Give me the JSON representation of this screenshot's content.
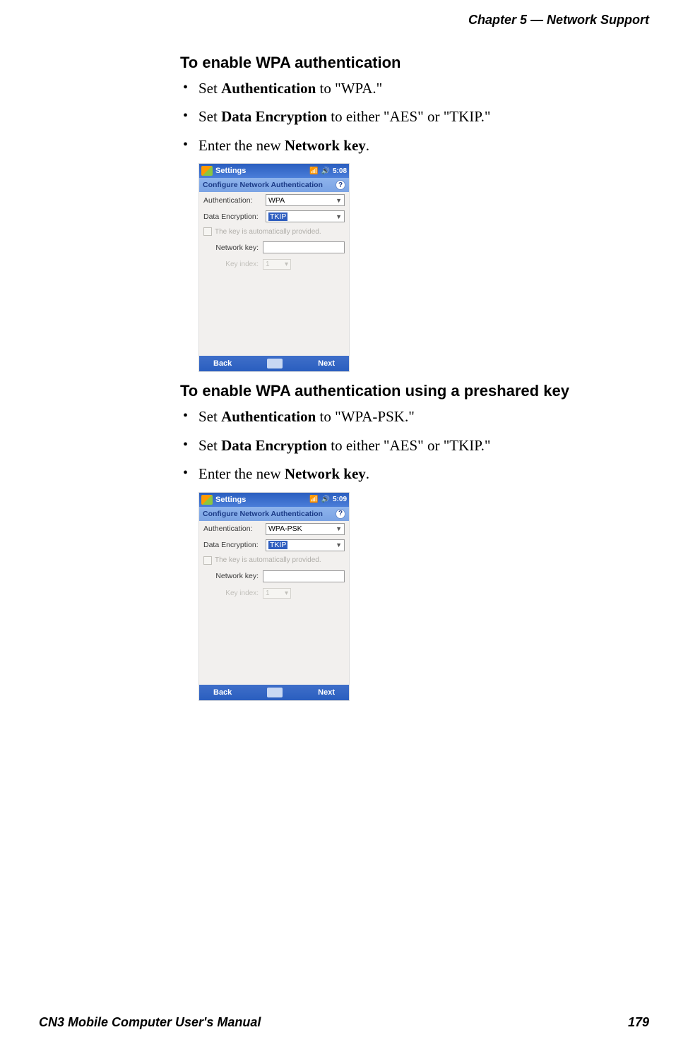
{
  "header": {
    "chapter": "Chapter 5 —  Network Support"
  },
  "footer": {
    "manual": "CN3 Mobile Computer User's Manual",
    "page": "179"
  },
  "section1": {
    "heading": "To enable WPA authentication",
    "b1_pre": "Set ",
    "b1_bold": "Authentication",
    "b1_post": " to \"WPA.\"",
    "b2_pre": "Set ",
    "b2_bold": "Data Encryption",
    "b2_post": " to either \"AES\" or \"TKIP.\"",
    "b3_pre": "Enter the new ",
    "b3_bold": "Network key",
    "b3_post": "."
  },
  "section2": {
    "heading": "To enable WPA authentication using a preshared key",
    "b1_pre": "Set ",
    "b1_bold": "Authentication",
    "b1_post": " to \"WPA-PSK.\"",
    "b2_pre": "Set ",
    "b2_bold": "Data Encryption",
    "b2_post": " to either \"AES\" or \"TKIP.\"",
    "b3_pre": "Enter the new ",
    "b3_bold": "Network key",
    "b3_post": "."
  },
  "screenshot1": {
    "title": "Settings",
    "time": "5:08",
    "subtitle": "Configure Network Authentication",
    "auth_label": "Authentication:",
    "auth_value": "WPA",
    "enc_label": "Data Encryption:",
    "enc_value": "TKIP",
    "auto_text": "The key is automatically provided.",
    "net_label": "Network key:",
    "keyidx_label": "Key index:",
    "keyidx_value": "1",
    "back": "Back",
    "next": "Next"
  },
  "screenshot2": {
    "title": "Settings",
    "time": "5:09",
    "subtitle": "Configure Network Authentication",
    "auth_label": "Authentication:",
    "auth_value": "WPA-PSK",
    "enc_label": "Data Encryption:",
    "enc_value": "TKIP",
    "auto_text": "The key is automatically provided.",
    "net_label": "Network key:",
    "keyidx_label": "Key index:",
    "keyidx_value": "1",
    "back": "Back",
    "next": "Next"
  }
}
